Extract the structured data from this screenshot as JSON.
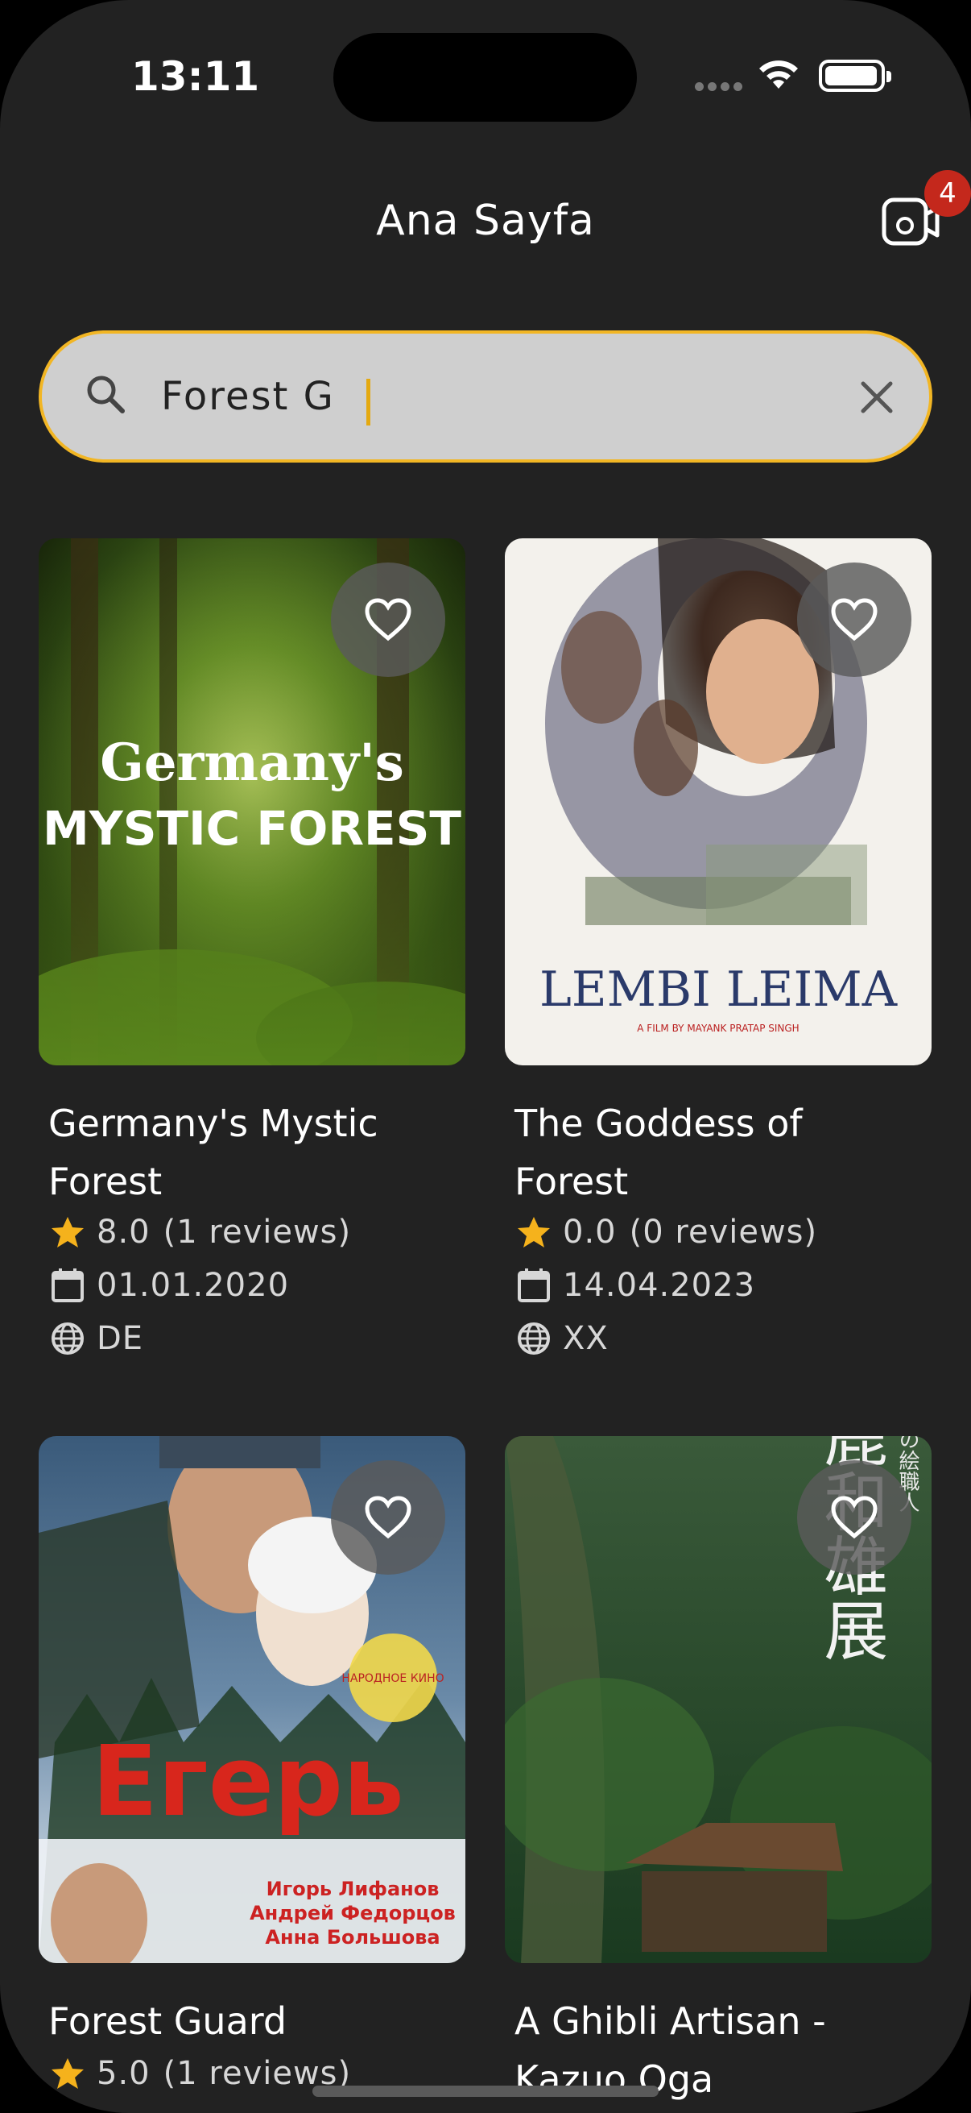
{
  "status": {
    "time": "13:11"
  },
  "header": {
    "title": "Ana Sayfa",
    "notification_count": "4",
    "icon": "video-camera-icon"
  },
  "search": {
    "value": "Forest G",
    "icon": "search-icon",
    "clear_icon": "close-icon"
  },
  "colors": {
    "background": "#222222",
    "accent": "#f2b624",
    "star": "#f5b21c",
    "badge": "#c4281c"
  },
  "movies": [
    {
      "title": "Germany's Mystic Forest",
      "rating": "8.0",
      "reviews": "(1 reviews)",
      "date": "01.01.2020",
      "country": "DE",
      "poster_text_top": "Germany's",
      "poster_text_bottom": "MYSTIC FOREST"
    },
    {
      "title": "The Goddess of Forest",
      "rating": "0.0",
      "reviews": "(0 reviews)",
      "date": "14.04.2023",
      "country": "XX",
      "poster_text": "LEMBI LEIMA",
      "poster_credit": "A FILM BY MAYANK PRATAP SINGH"
    },
    {
      "title": "Forest Guard",
      "rating": "5.0",
      "reviews": "(1 reviews)",
      "poster_text": "Егерь",
      "poster_cast": [
        "Игорь Лифанов",
        "Андрей Федорцов",
        "Анна Большова"
      ],
      "poster_stamp": "НАРОДНОЕ КИНО"
    },
    {
      "title": "A Ghibli Artisan - Kazuo Oga Exhibitio...",
      "poster_text": "男鹿和雄展",
      "poster_side": "りの絵職人"
    }
  ]
}
